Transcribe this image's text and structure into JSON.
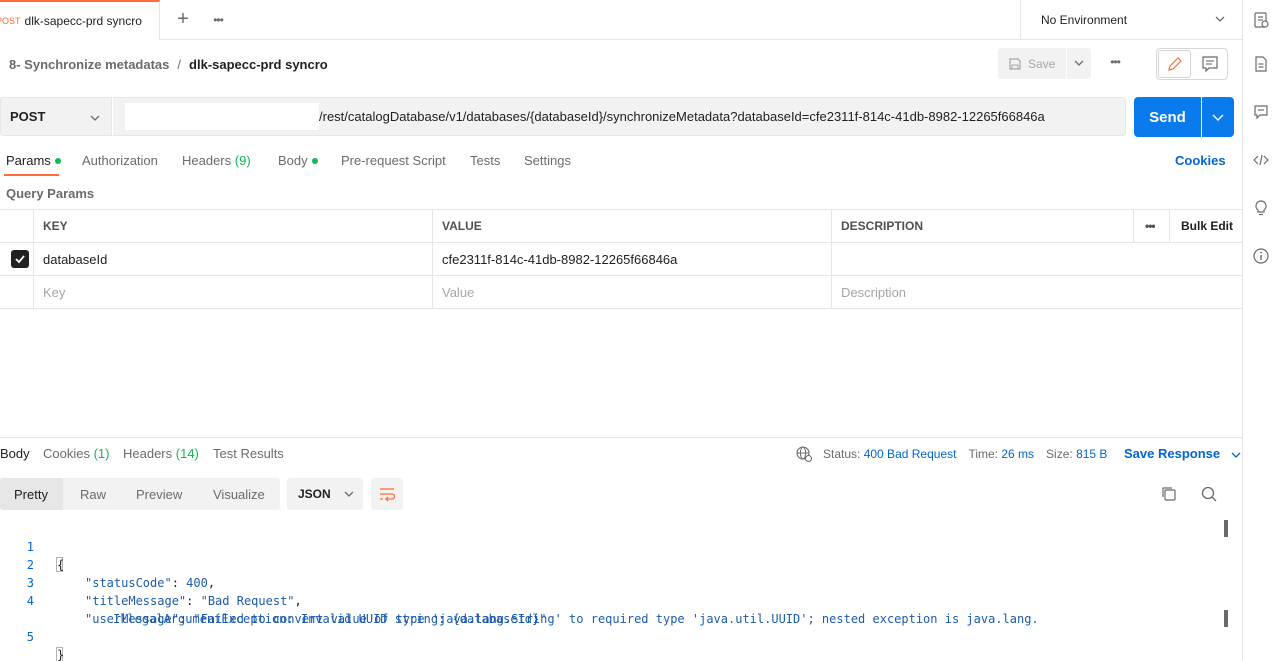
{
  "tab": {
    "method": "POST",
    "name": "dlk-sapecc-prd syncro"
  },
  "environment": {
    "selected": "No Environment"
  },
  "breadcrumb": {
    "parent": "8- Synchronize metadatas",
    "separator": "/",
    "current": "dlk-sapecc-prd syncro"
  },
  "toolbar": {
    "save_label": "Save"
  },
  "request": {
    "method": "POST",
    "url": "/rest/catalogDatabase/v1/databases/{databaseId}/synchronizeMetadata?databaseId=cfe2311f-814c-41db-8982-12265f66846a",
    "send_label": "Send"
  },
  "request_tabs": {
    "params": "Params",
    "authorization": "Authorization",
    "headers": "Headers",
    "headers_count": "(9)",
    "body": "Body",
    "pre_request": "Pre-request Script",
    "tests": "Tests",
    "settings": "Settings",
    "cookies": "Cookies"
  },
  "query_params": {
    "title": "Query Params",
    "columns": {
      "key": "KEY",
      "value": "VALUE",
      "description": "DESCRIPTION",
      "bulk_edit": "Bulk Edit"
    },
    "rows": [
      {
        "key": "databaseId",
        "value": "cfe2311f-814c-41db-8982-12265f66846a",
        "checked": true
      }
    ],
    "placeholders": {
      "key": "Key",
      "value": "Value",
      "description": "Description"
    }
  },
  "response_tabs": {
    "body": "Body",
    "cookies": "Cookies",
    "cookies_count": "(1)",
    "headers": "Headers",
    "headers_count": "(14)",
    "test_results": "Test Results"
  },
  "response_status": {
    "status_label": "Status:",
    "status_value": "400 Bad Request",
    "time_label": "Time:",
    "time_value": "26 ms",
    "size_label": "Size:",
    "size_value": "815 B",
    "save_response": "Save Response"
  },
  "view_modes": {
    "pretty": "Pretty",
    "raw": "Raw",
    "preview": "Preview",
    "visualize": "Visualize",
    "format": "JSON"
  },
  "response_body": {
    "line_numbers": [
      "1",
      "2",
      "3",
      "4",
      "5"
    ],
    "open_brace": "{",
    "close_brace": "}",
    "k_status": "\"statusCode\"",
    "v_status": "400",
    "k_title": "\"titleMessage\"",
    "v_title": "\"Bad Request\"",
    "k_user": "\"userMessage\"",
    "v_user_1": "\"Failed to convert value of type 'java.lang.String' to required type 'java.util.UUID'; nested exception is java.lang.",
    "v_user_2": "IllegalArgumentException: Invalid UUID string: {databaseId}\""
  },
  "colors": {
    "accent": "#ff6c37",
    "primary": "#097bed",
    "success": "#0cbb52",
    "link": "#0265d2"
  }
}
